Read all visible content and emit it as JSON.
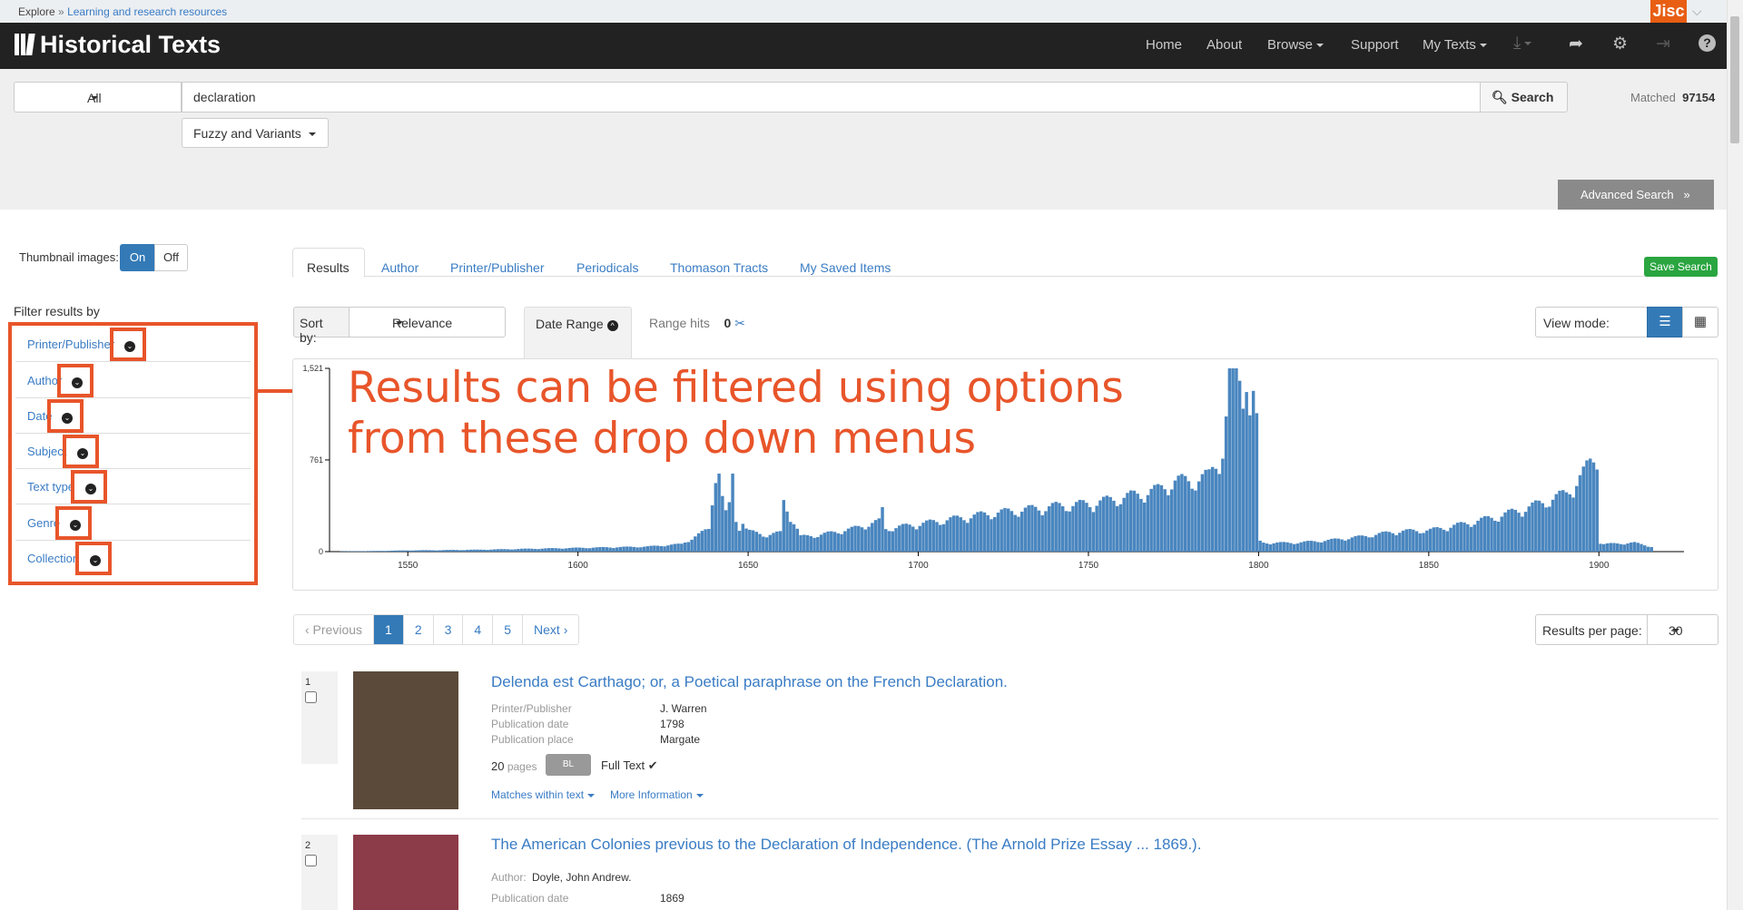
{
  "breadcrumb": {
    "root": "Explore",
    "separator": "»",
    "current": "Learning and research resources"
  },
  "jisc": {
    "logo": "Jisc"
  },
  "nav": {
    "brand": "Historical Texts",
    "items": [
      "Home",
      "About",
      "Browse",
      "Support",
      "My Texts"
    ],
    "icons": [
      "download-icon",
      "share-icon",
      "gear-icon",
      "sign-in-icon",
      "help-icon"
    ]
  },
  "search": {
    "scope": "All",
    "query": "declaration",
    "button": "Search",
    "mode": "Fuzzy and Variants",
    "matched_label": "Matched",
    "matched_count": "97154",
    "advanced": "Advanced Search"
  },
  "sidebar": {
    "thumbnail_label": "Thumbnail images:",
    "thumbnail_on": "On",
    "thumbnail_off": "Off",
    "filter_title": "Filter results by",
    "filters": [
      "Printer/Publisher",
      "Author",
      "Date",
      "Subject",
      "Text type",
      "Genre",
      "Collection"
    ]
  },
  "tabs": [
    "Results",
    "Author",
    "Printer/Publisher",
    "Periodicals",
    "Thomason Tracts",
    "My Saved Items"
  ],
  "save_search": "Save Search",
  "toolbar": {
    "sort_label": "Sort by:",
    "sort_value": "Relevance",
    "date_range": "Date Range",
    "range_hits_label": "Range hits",
    "range_hits_value": "0",
    "view_mode": "View mode:"
  },
  "annotation": "Results can be filtered using options from these drop down menus",
  "chart_data": {
    "type": "bar",
    "title": "",
    "xlabel": "",
    "ylabel": "",
    "x_ticks": [
      "1550",
      "1600",
      "1650",
      "1700",
      "1750",
      "1800",
      "1850",
      "1900"
    ],
    "y_ticks": [
      "0",
      "761",
      "1,521"
    ],
    "xlim": [
      1527,
      1925
    ],
    "ylim": [
      0,
      1521
    ],
    "bar_color": "#4a86bf",
    "years": [
      1530,
      1540,
      1550,
      1560,
      1570,
      1580,
      1590,
      1600,
      1610,
      1620,
      1630,
      1638,
      1640,
      1641,
      1642,
      1643,
      1644,
      1645,
      1646,
      1647,
      1648,
      1649,
      1650,
      1655,
      1659,
      1660,
      1665,
      1670,
      1680,
      1688,
      1689,
      1690,
      1700,
      1710,
      1720,
      1730,
      1740,
      1750,
      1760,
      1770,
      1775,
      1780,
      1785,
      1789,
      1790,
      1791,
      1792,
      1793,
      1794,
      1795,
      1796,
      1797,
      1798,
      1799,
      1800,
      1801,
      1810,
      1820,
      1830,
      1840,
      1850,
      1860,
      1870,
      1880,
      1890,
      1895,
      1897,
      1899,
      1900,
      1901,
      1910,
      1915
    ],
    "counts": [
      2,
      5,
      10,
      12,
      15,
      20,
      25,
      30,
      35,
      40,
      60,
      180,
      640,
      900,
      420,
      300,
      360,
      880,
      250,
      200,
      240,
      180,
      160,
      130,
      150,
      400,
      120,
      130,
      180,
      240,
      330,
      180,
      220,
      260,
      300,
      330,
      360,
      380,
      430,
      490,
      560,
      560,
      600,
      800,
      1050,
      1500,
      1400,
      1520,
      1380,
      1300,
      1450,
      1100,
      1200,
      1000,
      80,
      70,
      70,
      90,
      120,
      160,
      170,
      220,
      280,
      360,
      460,
      620,
      700,
      760,
      70,
      60,
      70,
      40
    ]
  },
  "pagination": [
    "‹ Previous",
    "1",
    "2",
    "3",
    "4",
    "5",
    "Next ›"
  ],
  "results_per_page_label": "Results per page:",
  "results_per_page": "30",
  "results": [
    {
      "num": "1",
      "title": "Delenda est Carthago; or, a Poetical paraphrase on the French Declaration.",
      "meta": [
        {
          "label": "Printer/Publisher",
          "value": "J. Warren"
        },
        {
          "label": "Publication date",
          "value": "1798"
        },
        {
          "label": "Publication place",
          "value": "Margate"
        }
      ],
      "pages": "20",
      "pages_label": "pages",
      "library": "BL",
      "full_text": "Full Text ✔",
      "matches_link": "Matches within text",
      "more_link": "More Information",
      "cover_color": "#5b4a3a"
    },
    {
      "num": "2",
      "title": "The American Colonies previous to the Declaration of Independence. (The Arnold Prize Essay ... 1869.).",
      "meta": [
        {
          "label": "Author:",
          "value": "Doyle, John Andrew."
        },
        {
          "label": "Publication date",
          "value": "1869"
        }
      ],
      "cover_color": "#8c3b48"
    }
  ]
}
